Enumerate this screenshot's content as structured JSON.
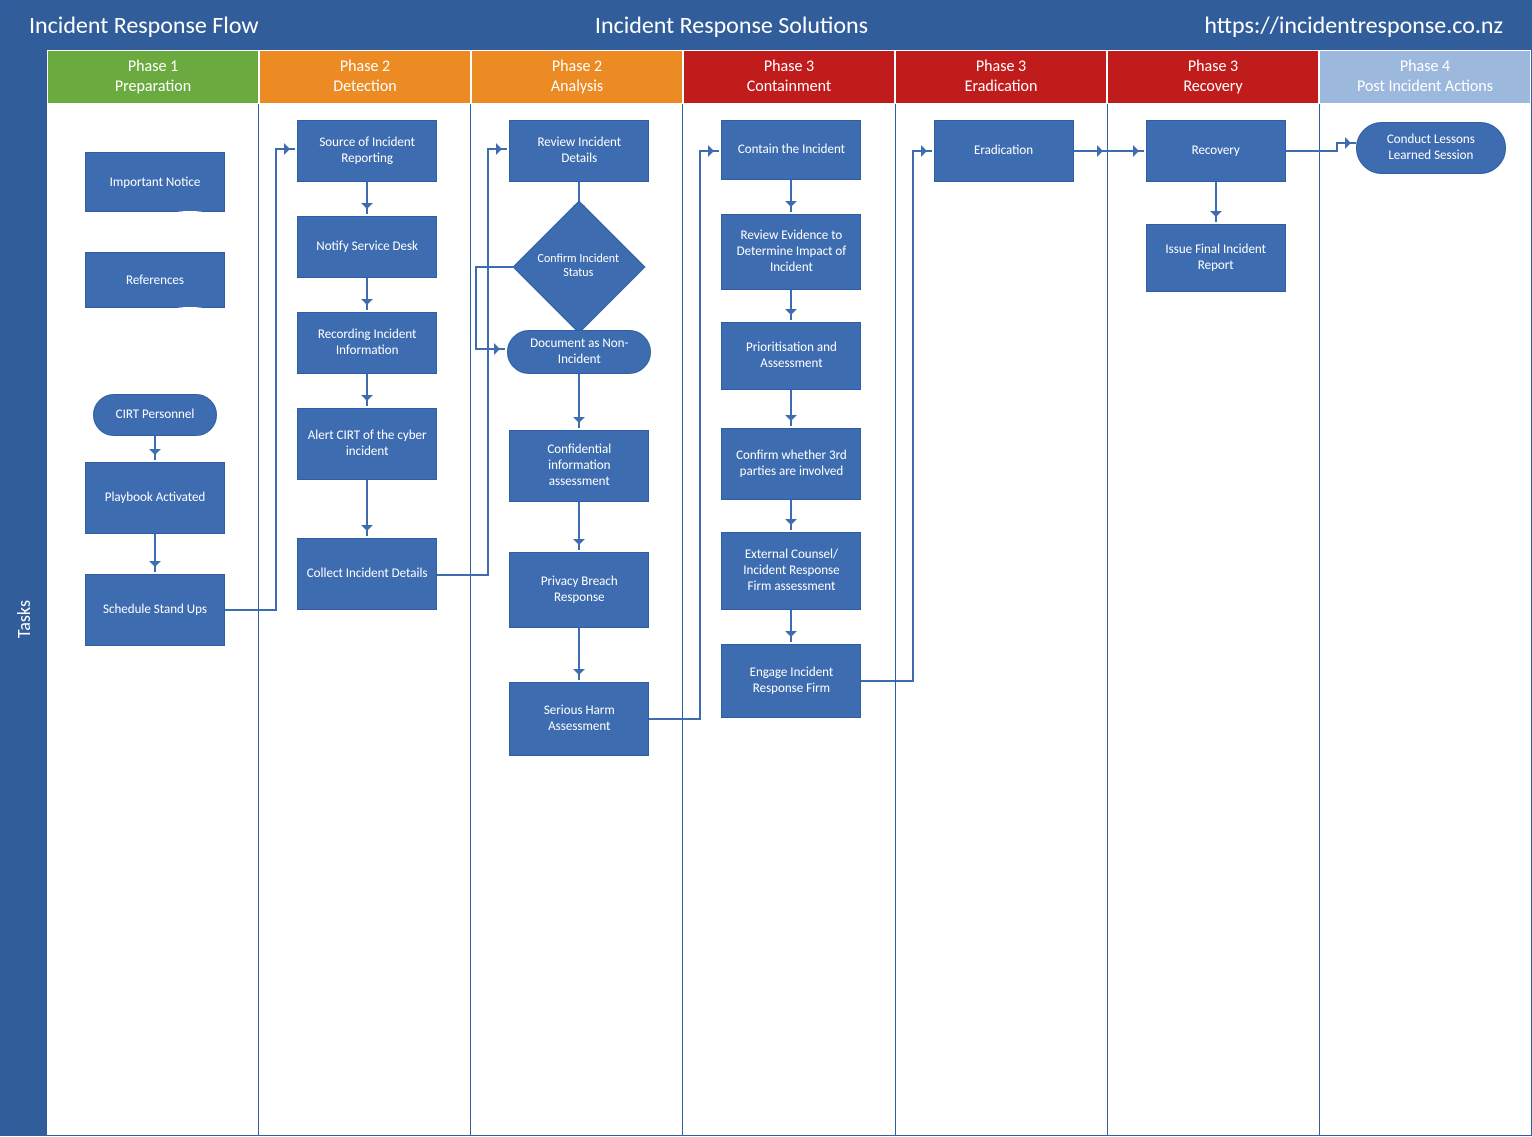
{
  "header": {
    "title": "Incident Response Flow",
    "subtitle": "Incident Response Solutions",
    "url": "https://incidentresponse.co.nz"
  },
  "tasks_label": "Tasks",
  "phases": [
    {
      "num": "Phase 1",
      "name": "Preparation",
      "color": "green"
    },
    {
      "num": "Phase 2",
      "name": "Detection",
      "color": "orange"
    },
    {
      "num": "Phase 2",
      "name": "Analysis",
      "color": "orange"
    },
    {
      "num": "Phase 3",
      "name": "Containment",
      "color": "red"
    },
    {
      "num": "Phase 3",
      "name": "Eradication",
      "color": "red"
    },
    {
      "num": "Phase 3",
      "name": "Recovery",
      "color": "red"
    },
    {
      "num": "Phase 4",
      "name": "Post Incident Actions",
      "color": "blue"
    }
  ],
  "lane1": {
    "important_notice": "Important Notice",
    "references": "References",
    "cirt_personnel": "CIRT Personnel",
    "playbook_activated": "Playbook Activated",
    "schedule_standups": "Schedule Stand Ups"
  },
  "lane2": {
    "source": "Source of Incident Reporting",
    "notify": "Notify Service Desk",
    "recording": "Recording Incident Information",
    "alert": "Alert CIRT of the cyber incident",
    "collect": "Collect Incident Details"
  },
  "lane3": {
    "review": "Review Incident Details",
    "confirm": "Confirm Incident Status",
    "nonincident": "Document as Non-Incident",
    "confidential": "Confidential information assessment",
    "privacy": "Privacy Breach Response",
    "harm": "Serious Harm Assessment"
  },
  "lane4": {
    "contain": "Contain the Incident",
    "review_evidence": "Review Evidence to Determine Impact of Incident",
    "priority": "Prioritisation and Assessment",
    "thirdparty": "Confirm whether 3rd parties are involved",
    "counsel": "External Counsel/ Incident Response Firm assessment",
    "engage": "Engage Incident Response Firm"
  },
  "lane5": {
    "eradication": "Eradication"
  },
  "lane6": {
    "recovery": "Recovery",
    "report": "Issue Final Incident Report"
  },
  "lane7": {
    "lessons": "Conduct Lessons Learned Session"
  }
}
